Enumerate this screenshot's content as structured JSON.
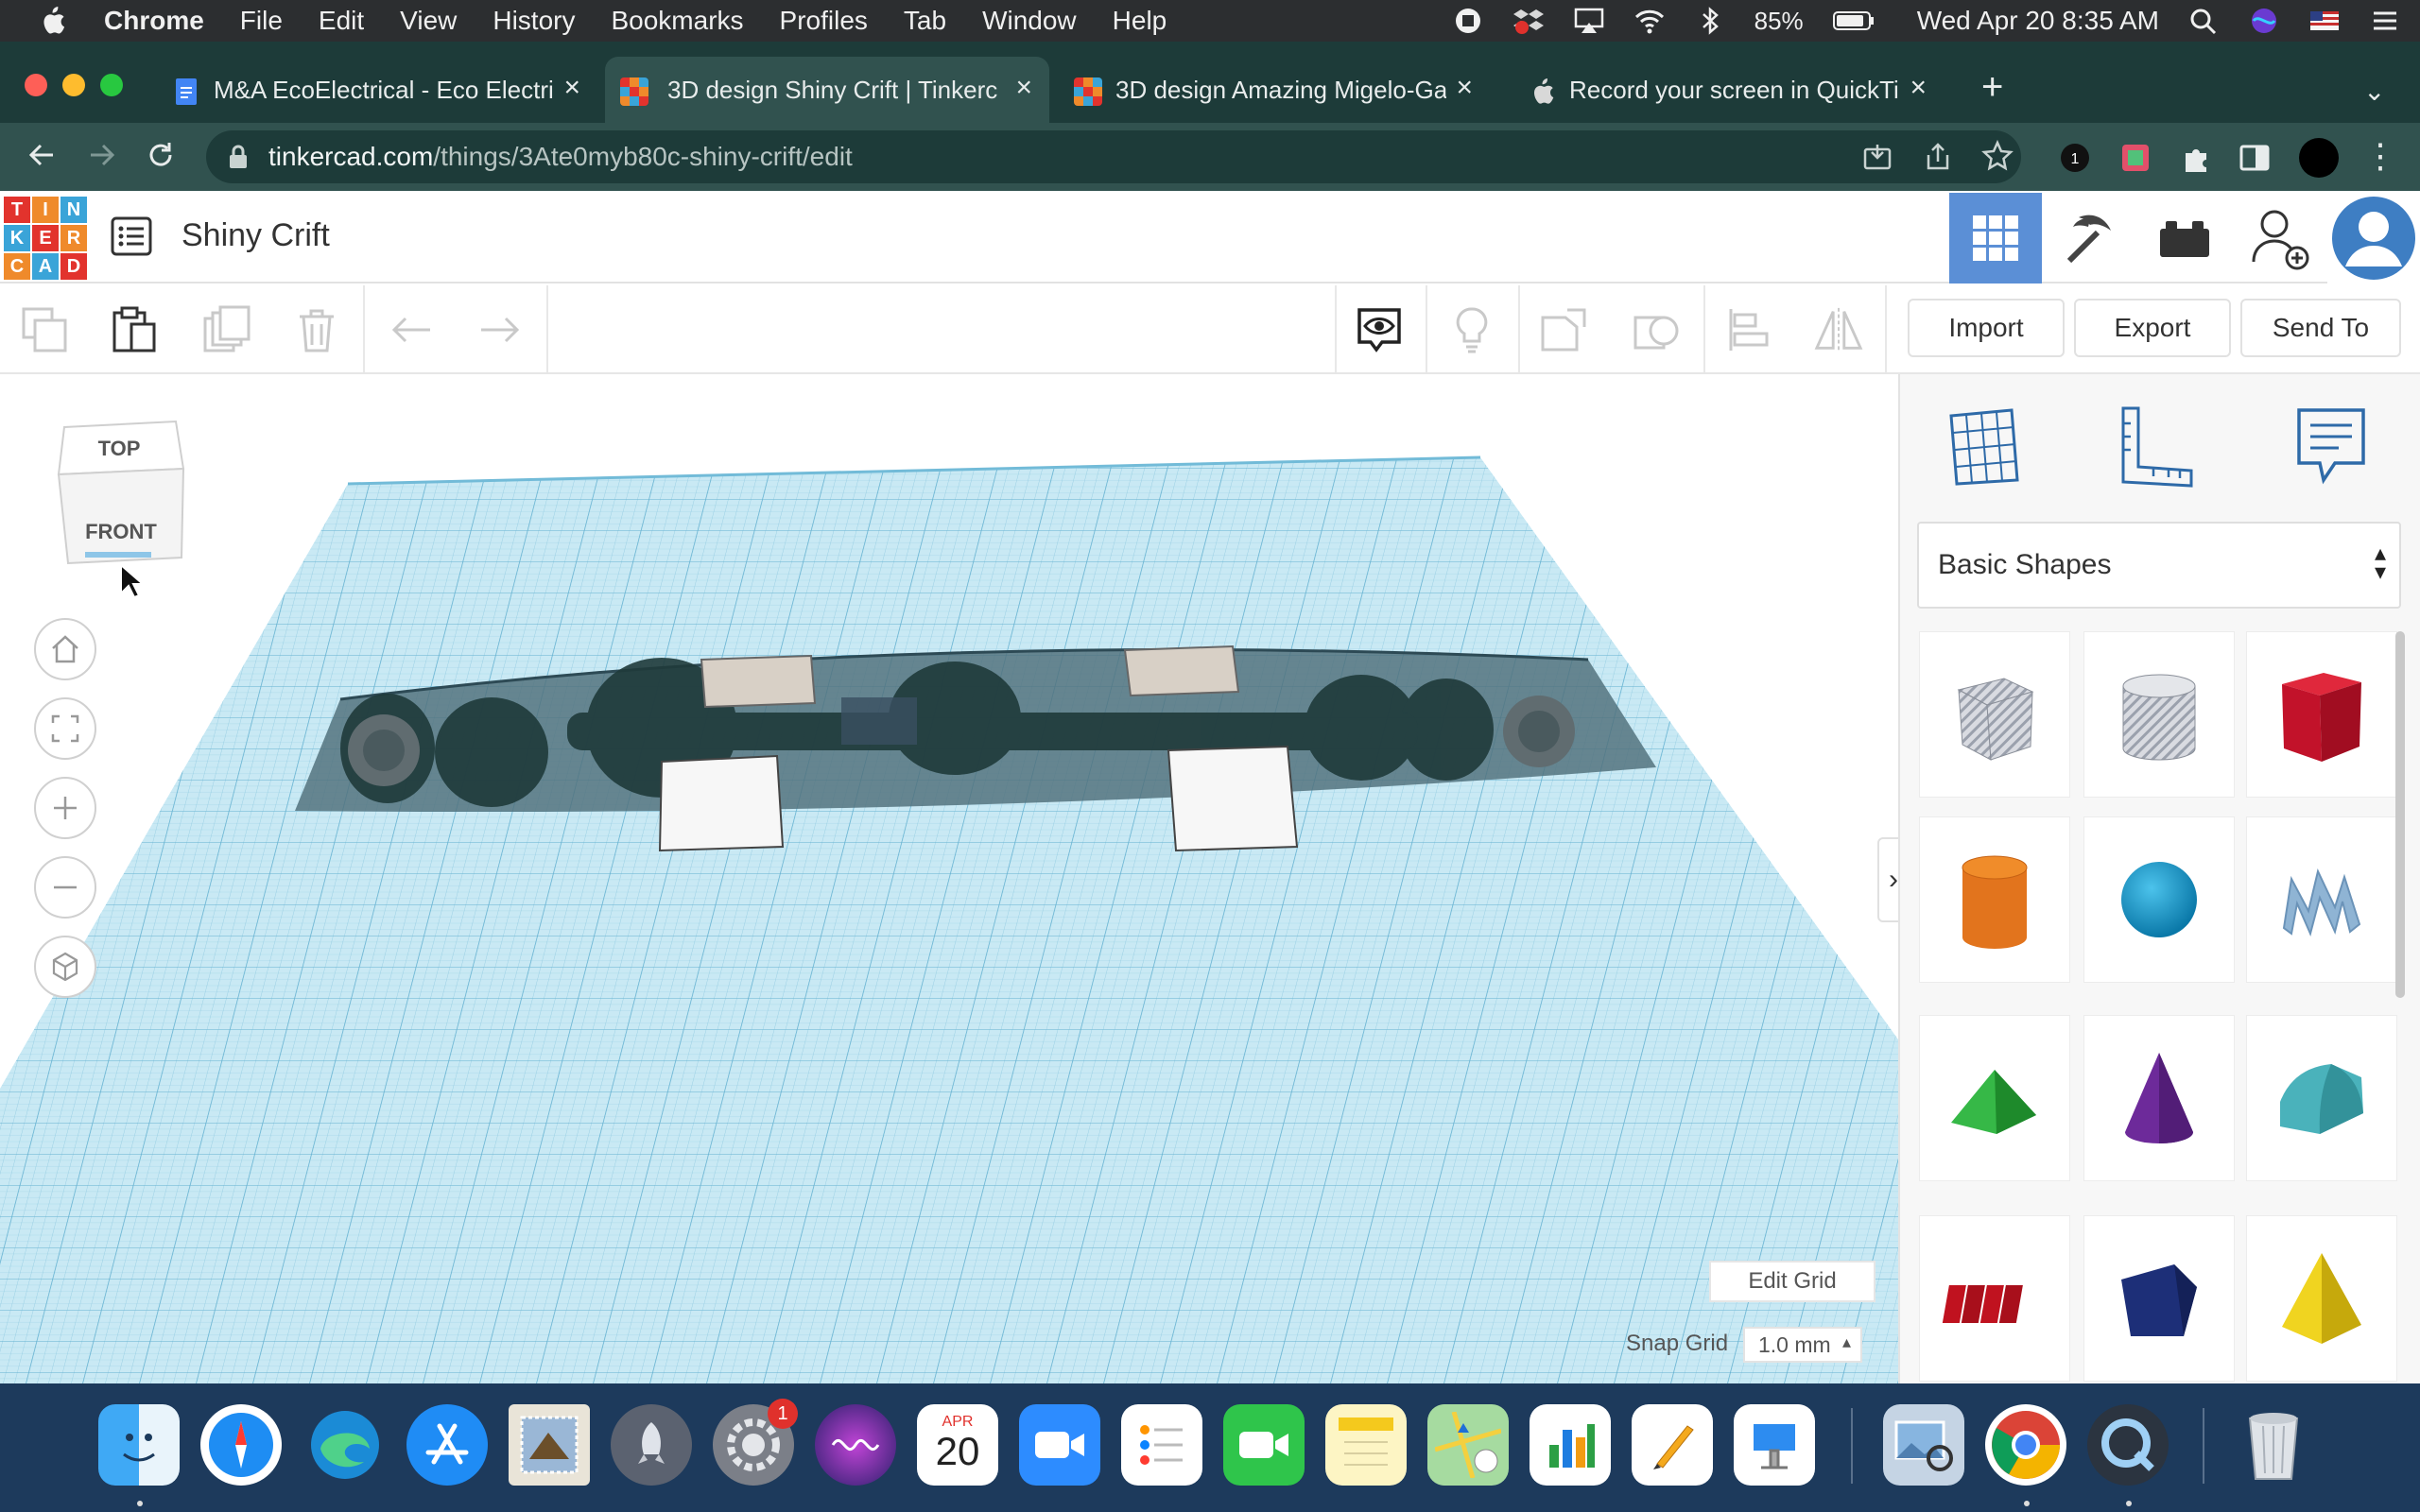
{
  "menubar": {
    "app_name": "Chrome",
    "items": [
      "File",
      "Edit",
      "View",
      "History",
      "Bookmarks",
      "Profiles",
      "Tab",
      "Window",
      "Help"
    ],
    "battery": "85%",
    "datetime": "Wed Apr 20  8:35 AM"
  },
  "browser": {
    "tabs": [
      {
        "label": "M&A EcoElectrical - Eco Electri",
        "favicon": "docs-icon",
        "active": false
      },
      {
        "label": "3D design Shiny Crift | Tinkerc",
        "favicon": "tinkercad-icon",
        "active": true
      },
      {
        "label": "3D design Amazing Migelo-Ga",
        "favicon": "tinkercad-icon",
        "active": false
      },
      {
        "label": "Record your screen in QuickTim",
        "favicon": "apple-icon",
        "active": false
      }
    ],
    "url_host": "tinkercad.com",
    "url_path": "/things/3Ate0myb80c-shiny-crift/edit",
    "extension_badge": "1"
  },
  "tinkercad": {
    "logo_letters": [
      "T",
      "I",
      "N",
      "K",
      "E",
      "R",
      "C",
      "A",
      "D"
    ],
    "logo_colors": [
      "#e2332d",
      "#ef8a2b",
      "#3aa4d8",
      "#3aa4d8",
      "#e2332d",
      "#ef8a2b",
      "#ef8a2b",
      "#3aa4d8",
      "#e2332d"
    ],
    "design_title": "Shiny Crift",
    "import_label": "Import",
    "export_label": "Export",
    "send_to_label": "Send To",
    "viewcube": {
      "top": "TOP",
      "front": "FRONT"
    },
    "edit_grid_label": "Edit Grid",
    "snap_grid_label": "Snap Grid",
    "snap_grid_value": "1.0 mm",
    "shape_category": "Basic Shapes",
    "shapes": [
      {
        "name": "box-hole",
        "color": "#c9ccd4"
      },
      {
        "name": "cylinder-hole",
        "color": "#c9ccd4"
      },
      {
        "name": "box",
        "color": "#d0142a"
      },
      {
        "name": "cylinder",
        "color": "#e2741d"
      },
      {
        "name": "sphere",
        "color": "#1494c6"
      },
      {
        "name": "scribble",
        "color": "#8fb4d4"
      },
      {
        "name": "roof",
        "color": "#2ea43a"
      },
      {
        "name": "cone",
        "color": "#6d2a9a"
      },
      {
        "name": "round-roof",
        "color": "#4ab2bb"
      },
      {
        "name": "text",
        "color": "#c0121f"
      },
      {
        "name": "polygon",
        "color": "#1d2f78"
      },
      {
        "name": "pyramid",
        "color": "#e8cc12"
      }
    ]
  },
  "dock": {
    "calendar_month": "APR",
    "calendar_day": "20",
    "settings_badge": "1"
  }
}
